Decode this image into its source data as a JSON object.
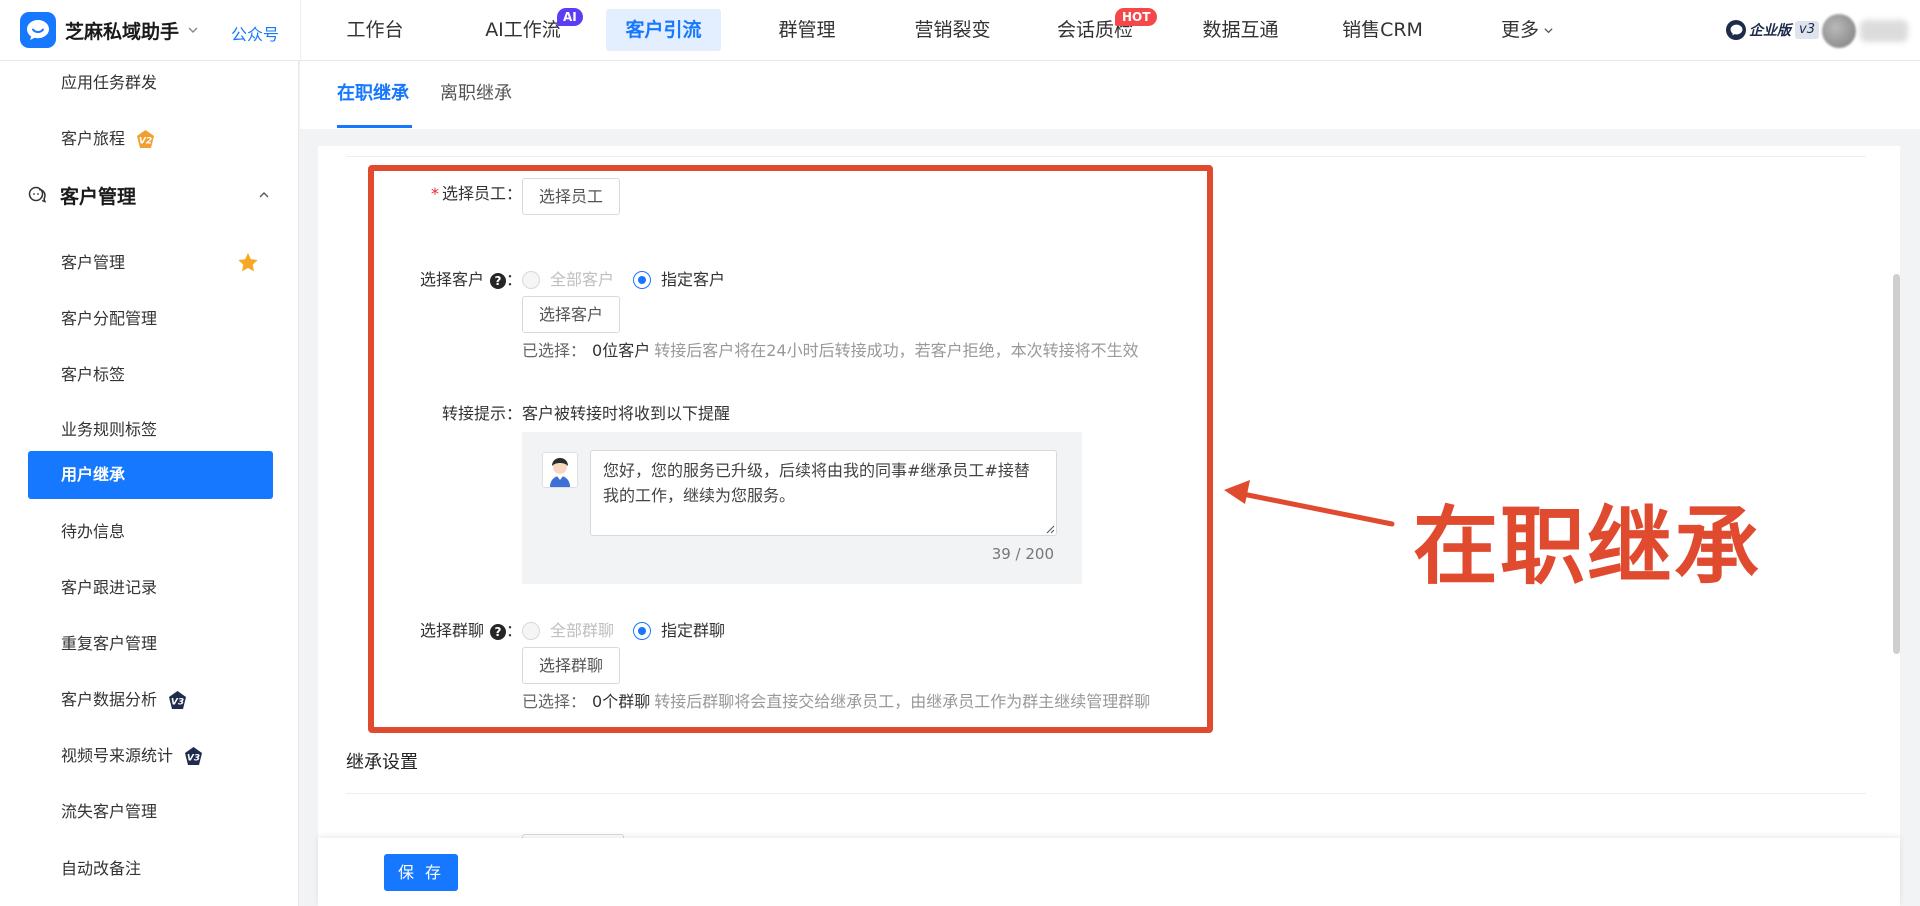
{
  "app": {
    "name": "芝麻私域助手",
    "gzh": "公众号",
    "edition": "企业版",
    "version": "v3"
  },
  "nav": {
    "items": [
      {
        "label": "工作台"
      },
      {
        "label": "AI工作流",
        "badge": "AI"
      },
      {
        "label": "客户引流",
        "active": true
      },
      {
        "label": "群管理"
      },
      {
        "label": "营销裂变"
      },
      {
        "label": "会话质检",
        "badge": "HOT"
      },
      {
        "label": "数据互通"
      },
      {
        "label": "销售CRM"
      },
      {
        "label": "更多"
      }
    ]
  },
  "sidebar": {
    "items_before": [
      {
        "label": "应用任务群发"
      },
      {
        "label": "客户旅程",
        "tag": "v2"
      }
    ],
    "group": {
      "label": "客户管理"
    },
    "items": [
      {
        "label": "客户管理",
        "star": true
      },
      {
        "label": "客户分配管理"
      },
      {
        "label": "客户标签"
      },
      {
        "label": "业务规则标签"
      },
      {
        "label": "用户继承",
        "active": true
      },
      {
        "label": "待办信息"
      },
      {
        "label": "客户跟进记录"
      },
      {
        "label": "重复客户管理"
      },
      {
        "label": "客户数据分析",
        "tag": "v3"
      },
      {
        "label": "视频号来源统计",
        "tag": "v3"
      },
      {
        "label": "流失客户管理"
      },
      {
        "label": "自动改备注"
      }
    ]
  },
  "tabs": [
    {
      "label": "在职继承",
      "active": true
    },
    {
      "label": "离职继承"
    }
  ],
  "form": {
    "employee": {
      "label": "选择员工：",
      "button": "选择员工"
    },
    "customer": {
      "label": "选择客户",
      "colon": "：",
      "options": [
        {
          "label": "全部客户",
          "disabled": true
        },
        {
          "label": "指定客户",
          "checked": true
        }
      ],
      "button": "选择客户",
      "selected_prefix": "已选择：",
      "selected_count": "0位客户",
      "hint": "转接后客户将在24小时后转接成功，若客户拒绝，本次转接将不生效"
    },
    "notice": {
      "label": "转接提示：",
      "desc": "客户被转接时将收到以下提醒",
      "message": "您好，您的服务已升级，后续将由我的同事#继承员工#接替我的工作，继续为您服务。",
      "counter": "39 / 200"
    },
    "group": {
      "label": "选择群聊",
      "colon": "：",
      "options": [
        {
          "label": "全部群聊",
          "disabled": true
        },
        {
          "label": "指定群聊",
          "checked": true
        }
      ],
      "button": "选择群聊",
      "selected_prefix": "已选择：",
      "selected_count": "0个群聊",
      "hint": "转接后群聊将会直接交给继承员工，由继承员工作为群主继续管理群聊"
    },
    "section_title": "继承设置",
    "save": "保 存"
  },
  "annotation": {
    "text": "在职继承",
    "color": "#e04a2e"
  },
  "colors": {
    "primary": "#1677ff",
    "ai_badge": "#5b3df5",
    "hot_badge": "#f5484a",
    "required": "#f5222d"
  }
}
